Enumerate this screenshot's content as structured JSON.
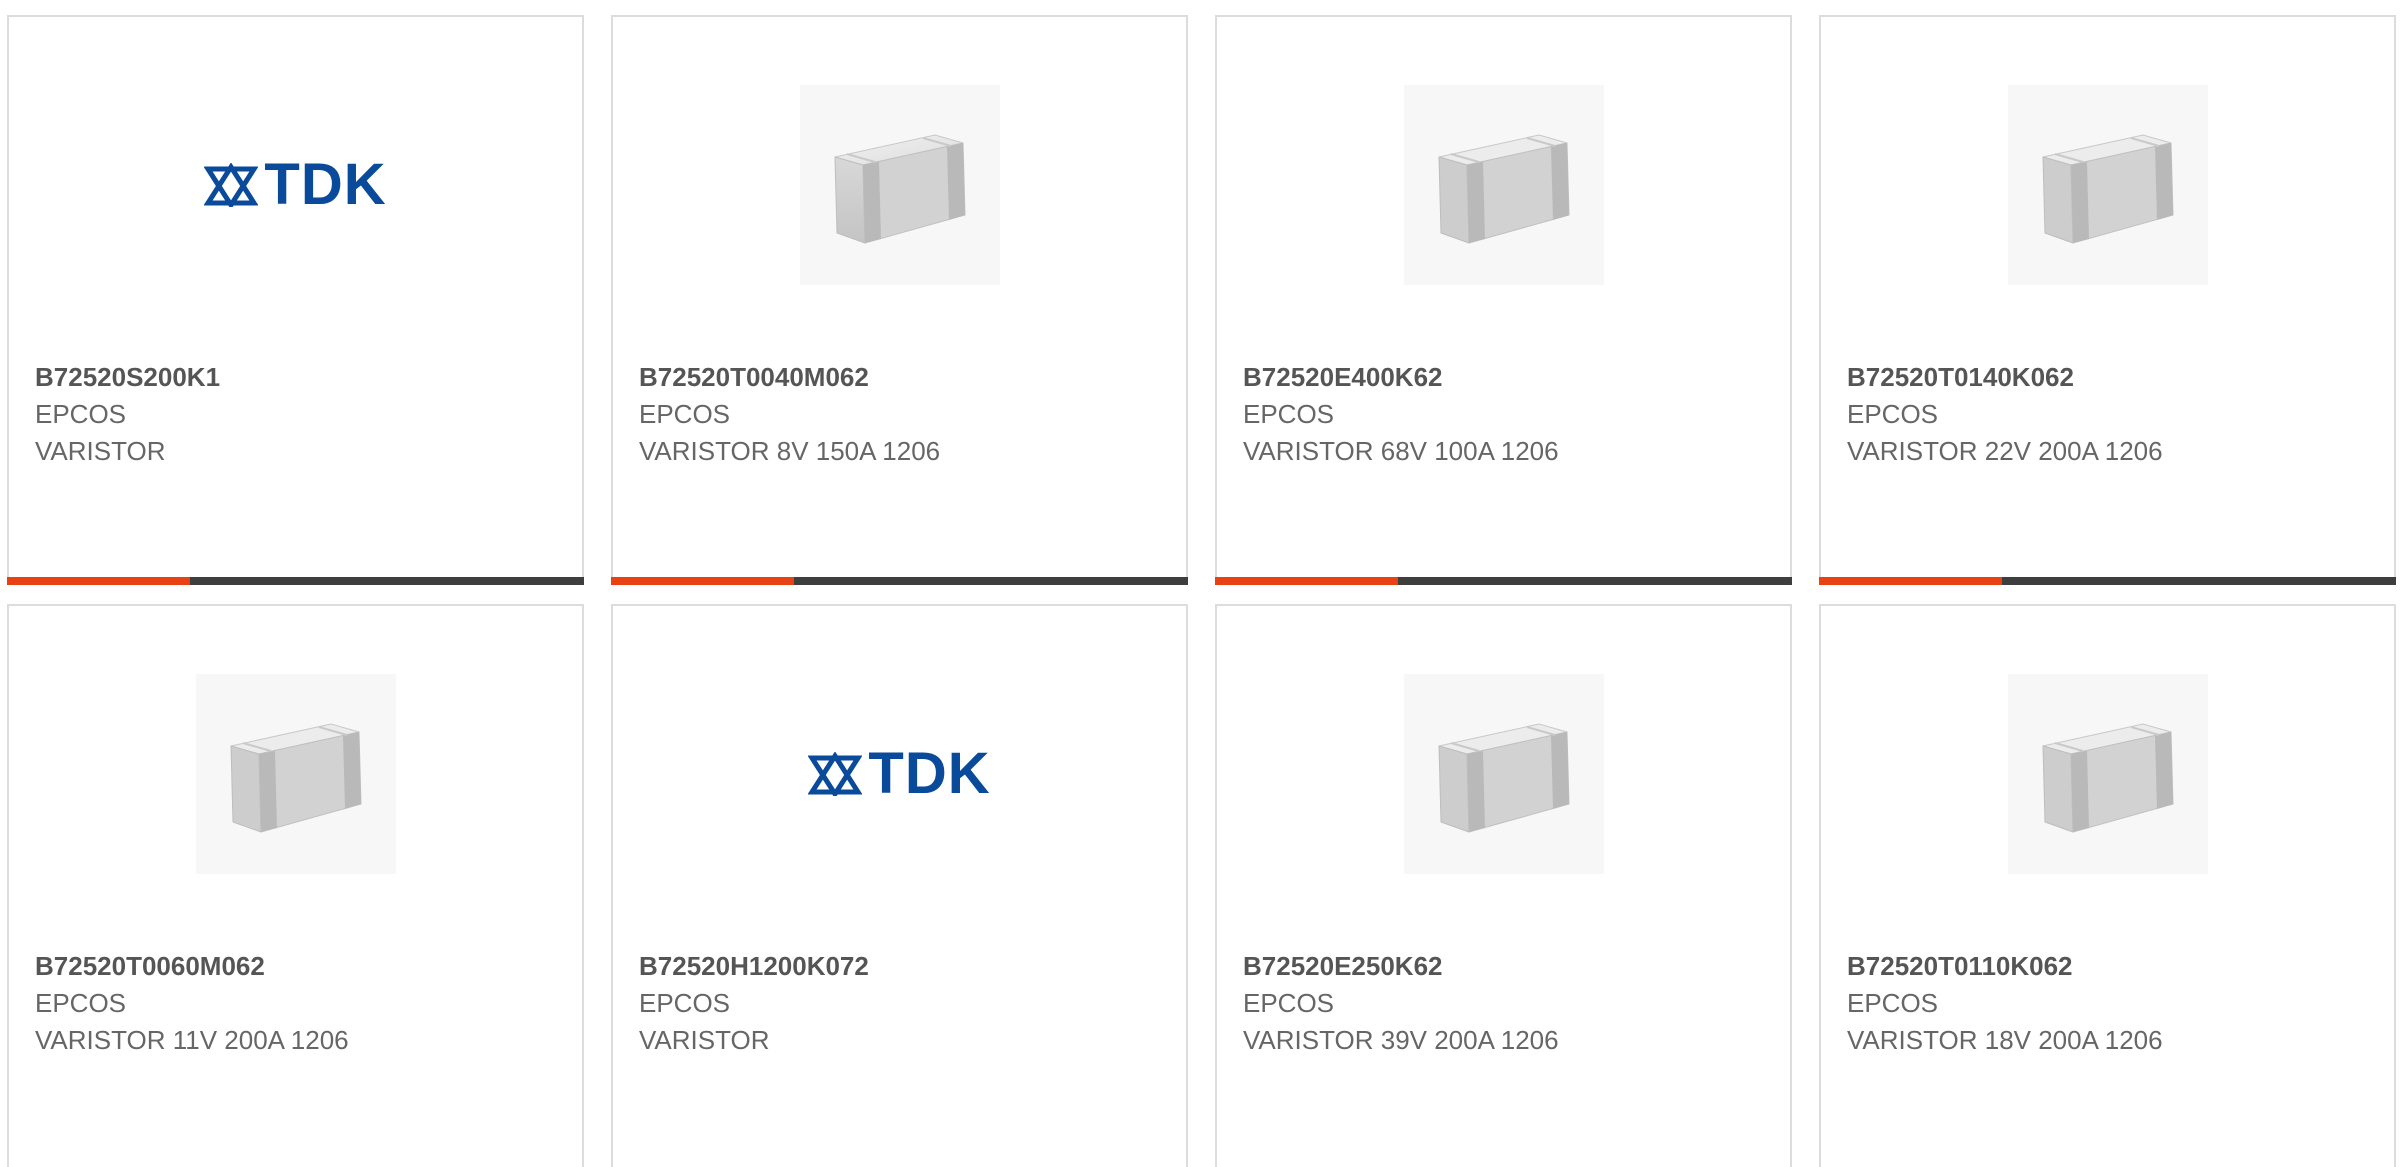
{
  "theme": {
    "accent": "#e84113",
    "bar_dark": "#3e3e3e",
    "logo_blue": "#0a4a9b"
  },
  "products": [
    {
      "image": "tdk-logo",
      "part_number": "B72520S200K1",
      "brand": "EPCOS",
      "description": "VARISTOR",
      "logo_text": "TDK"
    },
    {
      "image": "chip-varistor",
      "part_number": "B72520T0040M062",
      "brand": "EPCOS",
      "description": "VARISTOR 8V 150A 1206"
    },
    {
      "image": "chip-varistor",
      "part_number": "B72520E400K62",
      "brand": "EPCOS",
      "description": "VARISTOR 68V 100A 1206"
    },
    {
      "image": "chip-varistor",
      "part_number": "B72520T0140K062",
      "brand": "EPCOS",
      "description": "VARISTOR 22V 200A 1206"
    },
    {
      "image": "chip-varistor",
      "part_number": "B72520T0060M062",
      "brand": "EPCOS",
      "description": "VARISTOR 11V 200A 1206"
    },
    {
      "image": "tdk-logo",
      "part_number": "B72520H1200K072",
      "brand": "EPCOS",
      "description": "VARISTOR",
      "logo_text": "TDK"
    },
    {
      "image": "chip-varistor",
      "part_number": "B72520E250K62",
      "brand": "EPCOS",
      "description": "VARISTOR 39V 200A 1206"
    },
    {
      "image": "chip-varistor",
      "part_number": "B72520T0110K062",
      "brand": "EPCOS",
      "description": "VARISTOR 18V 200A 1206"
    }
  ]
}
